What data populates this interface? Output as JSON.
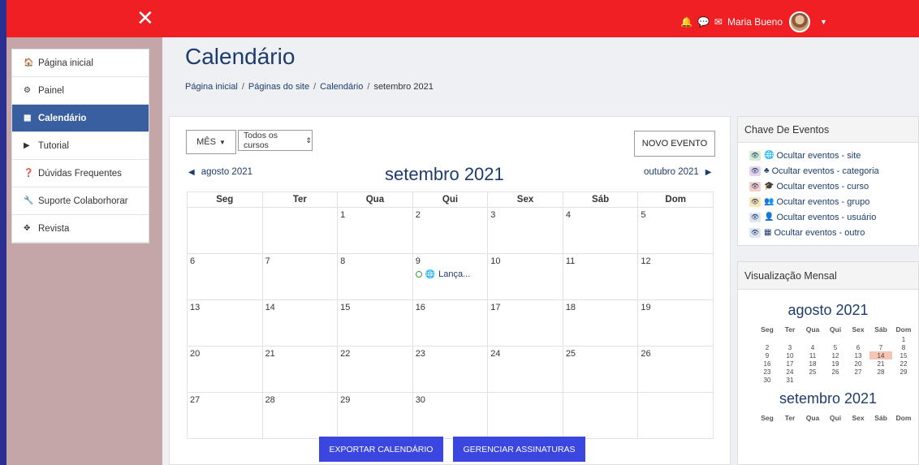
{
  "topbar": {
    "close_icon": "close-icon",
    "user_name": "Maria Bueno"
  },
  "sidebar": {
    "items": [
      {
        "label": "Página inicial",
        "icon": "home-icon",
        "glyph": "🏠"
      },
      {
        "label": "Painel",
        "icon": "dashboard-icon",
        "glyph": "⚙"
      },
      {
        "label": "Calendário",
        "icon": "calendar-icon",
        "glyph": "▦"
      },
      {
        "label": "Tutorial",
        "icon": "play-icon",
        "glyph": "▶"
      },
      {
        "label": "Dúvidas Frequentes",
        "icon": "question-icon",
        "glyph": "❓"
      },
      {
        "label": "Suporte Colaborhorar",
        "icon": "wrench-icon",
        "glyph": "🔧"
      },
      {
        "label": "Revista",
        "icon": "move-icon",
        "glyph": "✥"
      }
    ]
  },
  "page": {
    "title": "Calendário",
    "breadcrumb": [
      "Página inicial",
      "Páginas do site",
      "Calendário",
      "setembro 2021"
    ]
  },
  "calendar": {
    "view_button": "MÊS",
    "course_select": "Todos os cursos",
    "new_event_button": "NOVO EVENTO",
    "prev_month": "agosto 2021",
    "next_month": "outubro 2021",
    "month_title": "setembro 2021",
    "weekdays": [
      "Seg",
      "Ter",
      "Qua",
      "Qui",
      "Sex",
      "Sáb",
      "Dom"
    ],
    "weeks": [
      [
        "",
        "",
        "1",
        "2",
        "3",
        "4",
        "5"
      ],
      [
        "6",
        "7",
        "8",
        "9",
        "10",
        "11",
        "12"
      ],
      [
        "13",
        "14",
        "15",
        "16",
        "17",
        "18",
        "19"
      ],
      [
        "20",
        "21",
        "22",
        "23",
        "24",
        "25",
        "26"
      ],
      [
        "27",
        "28",
        "29",
        "30",
        "",
        "",
        ""
      ]
    ],
    "event": {
      "label": "Lança..."
    },
    "export_button": "EXPORTAR CALENDÁRIO",
    "subscriptions_button": "GERENCIAR ASSINATURAS"
  },
  "event_key": {
    "title": "Chave De Eventos",
    "items": [
      {
        "label": "Ocultar eventos - site",
        "color": "#d6ecd6",
        "icon": "globe-icon",
        "glyph": "🌐"
      },
      {
        "label": "Ocultar eventos - categoria",
        "color": "#e6d3ea",
        "icon": "cubes-icon",
        "glyph": "♣"
      },
      {
        "label": "Ocultar eventos - curso",
        "color": "#f6d0c8",
        "icon": "graduation-cap-icon",
        "glyph": "🎓"
      },
      {
        "label": "Ocultar eventos - grupo",
        "color": "#fbe6b5",
        "icon": "users-icon",
        "glyph": "👥"
      },
      {
        "label": "Ocultar eventos - usuário",
        "color": "#dfe6f2",
        "icon": "user-icon",
        "glyph": "👤"
      },
      {
        "label": "Ocultar eventos - outro",
        "color": "#dfe6f2",
        "icon": "calendar-icon",
        "glyph": "▦"
      }
    ]
  },
  "monthly_view": {
    "title": "Visualização Mensal",
    "weekdays": [
      "Seg",
      "Ter",
      "Qua",
      "Qui",
      "Sex",
      "Sáb",
      "Dom"
    ],
    "august": {
      "title": "agosto 2021",
      "today": "14",
      "weeks": [
        [
          "",
          "",
          "",
          "",
          "",
          "",
          "1"
        ],
        [
          "2",
          "3",
          "4",
          "5",
          "6",
          "7",
          "8"
        ],
        [
          "9",
          "10",
          "11",
          "12",
          "13",
          "14",
          "15"
        ],
        [
          "16",
          "17",
          "18",
          "19",
          "20",
          "21",
          "22"
        ],
        [
          "23",
          "24",
          "25",
          "26",
          "27",
          "28",
          "29"
        ],
        [
          "30",
          "31",
          "",
          "",
          "",
          "",
          ""
        ]
      ]
    },
    "september": {
      "title": "setembro 2021"
    }
  },
  "colors": {
    "topbar": "#ef1f24",
    "sidebar_active": "#3a5fa0",
    "accent_blue": "#3b46e0",
    "heading": "#1d3c6e"
  }
}
